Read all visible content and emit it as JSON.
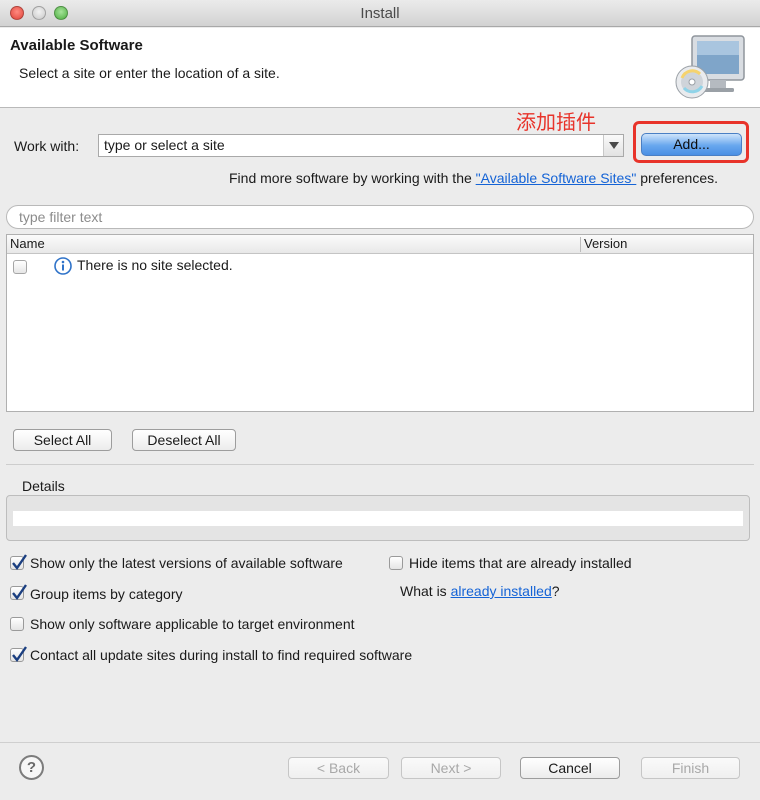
{
  "window": {
    "title": "Install"
  },
  "banner": {
    "title": "Available Software",
    "subtitle": "Select a site or enter the location of a site."
  },
  "annotation": {
    "text": "添加插件",
    "color": "#e8332a"
  },
  "work_with": {
    "label": "Work with:",
    "value": "type or select a site",
    "add_button": "Add..."
  },
  "find_more": {
    "prefix": "Find more software by working with the ",
    "link": "\"Available Software Sites\"",
    "suffix": " preferences."
  },
  "filter": {
    "placeholder": "type filter text"
  },
  "table": {
    "columns": [
      "Name",
      "Version"
    ],
    "rows": [
      {
        "checked": false,
        "icon": "info-icon",
        "text": "There is no site selected."
      }
    ]
  },
  "buttons": {
    "select_all": "Select All",
    "deselect_all": "Deselect All"
  },
  "details": {
    "label": "Details",
    "content": ""
  },
  "options": [
    {
      "label": "Show only the latest versions of available software",
      "checked": true
    },
    {
      "label": "Group items by category",
      "checked": true
    },
    {
      "label": "Show only software applicable to target environment",
      "checked": false
    },
    {
      "label": "Contact all update sites during install to find required software",
      "checked": true
    },
    {
      "label": "Hide items that are already installed",
      "checked": false
    }
  ],
  "installed_query": {
    "prefix": "What is ",
    "link": "already installed",
    "suffix": "?"
  },
  "footer": {
    "help": "?",
    "back": "< Back",
    "next": "Next >",
    "cancel": "Cancel",
    "finish": "Finish"
  },
  "colors": {
    "accent": "#4a8fe4",
    "link": "#1463d6",
    "highlight": "#e8332a"
  }
}
